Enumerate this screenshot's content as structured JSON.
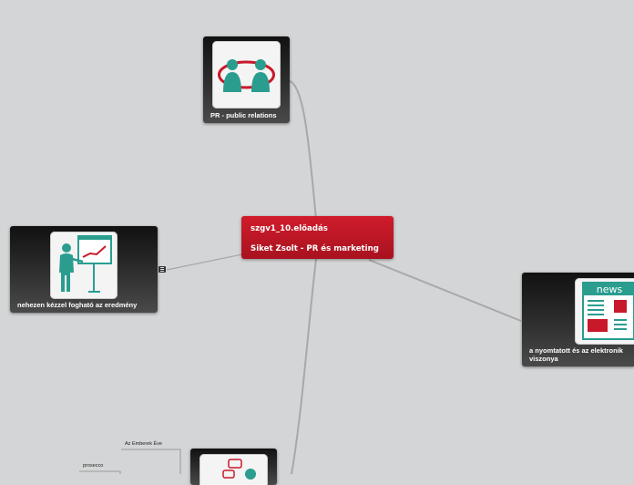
{
  "central": {
    "line1": "szgv1_10.előadás",
    "line2": "Siket Zsolt - PR és marketing"
  },
  "nodes": {
    "pr": {
      "label": "PR - public relations",
      "icon": "people-circle-icon"
    },
    "result": {
      "label": "nehezen kézzel fogható az eredmény",
      "icon": "presentation-icon"
    },
    "news": {
      "label_line1": "a nyomtatott és az elektronik",
      "label_line2": "viszonya",
      "icon": "newspaper-icon"
    },
    "chat": {
      "icon": "chat-person-icon"
    }
  },
  "small_labels": {
    "emberek": "Az Emberek Éve",
    "prosecco": "prosecco"
  },
  "colors": {
    "background": "#d4d5d6",
    "central": "#c8192a",
    "accent_teal": "#2a9d8f",
    "accent_red": "#c8192a"
  }
}
